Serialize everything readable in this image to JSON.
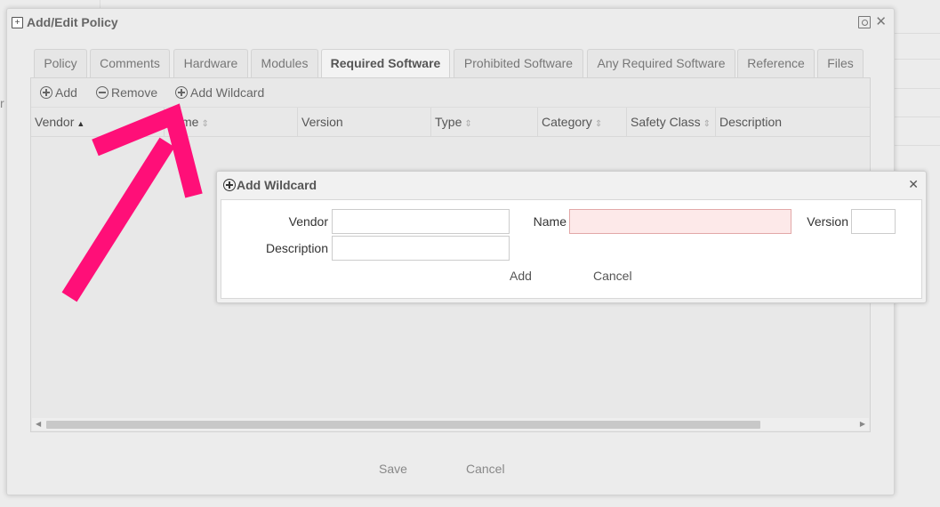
{
  "dialog": {
    "title": "Add/Edit Policy",
    "tabs": [
      {
        "label": "Policy",
        "active": false
      },
      {
        "label": "Comments",
        "active": false
      },
      {
        "label": "Hardware",
        "active": false
      },
      {
        "label": "Modules",
        "active": false
      },
      {
        "label": "Required Software",
        "active": true
      },
      {
        "label": "Prohibited Software",
        "active": false
      },
      {
        "label": "Any Required Software",
        "active": false
      },
      {
        "label": "Reference",
        "active": false
      },
      {
        "label": "Files",
        "active": false
      }
    ],
    "toolbar": {
      "add_label": "Add",
      "remove_label": "Remove",
      "add_wildcard_label": "Add Wildcard"
    },
    "columns": [
      "Vendor",
      "Name",
      "Version",
      "Type",
      "Category",
      "Safety Class",
      "Description"
    ],
    "visible_name_column_text": "me",
    "footer": {
      "save_label": "Save",
      "cancel_label": "Cancel"
    }
  },
  "wildcard_dialog": {
    "title": "Add Wildcard",
    "fields": {
      "vendor_label": "Vendor",
      "vendor_value": "",
      "name_label": "Name",
      "name_value": "",
      "version_label": "Version",
      "version_value": "",
      "description_label": "Description",
      "description_value": ""
    },
    "add_label": "Add",
    "cancel_label": "Cancel"
  },
  "background": {
    "stub_text": "r"
  },
  "colors": {
    "annotation_arrow": "#ff0f78",
    "invalid_field_bg": "#fde9e9"
  }
}
